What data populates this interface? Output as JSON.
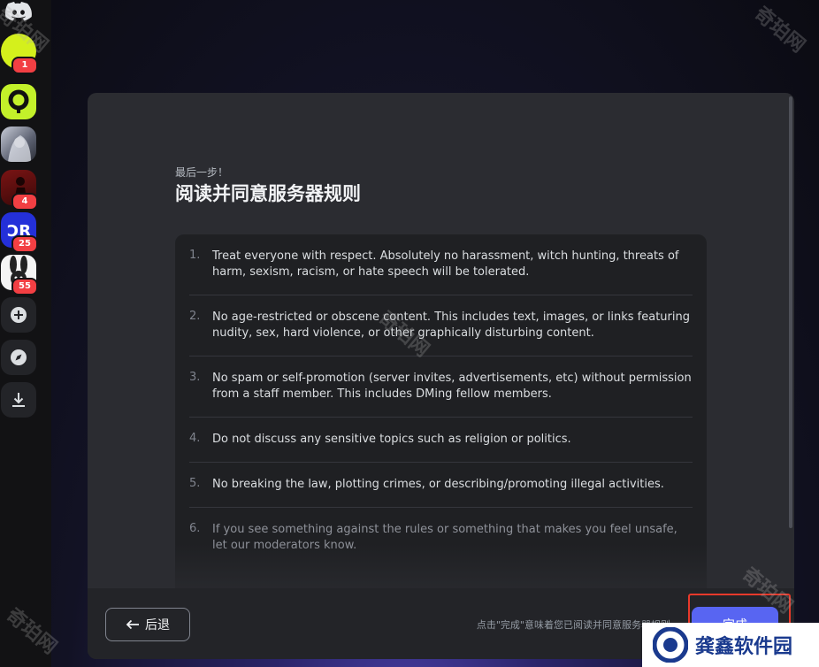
{
  "servers": [
    {
      "name": "discord-home",
      "badge": null
    },
    {
      "name": "lime-server",
      "badge": "1"
    },
    {
      "name": "green-ring-server",
      "badge": null
    },
    {
      "name": "anime-server",
      "badge": null
    },
    {
      "name": "red-figure-server",
      "badge": "4"
    },
    {
      "name": "cr-server",
      "badge": "25"
    },
    {
      "name": "bunny-server",
      "badge": "55"
    }
  ],
  "modal": {
    "step": "最后一步！",
    "title": "阅读并同意服务器规则",
    "rules": [
      {
        "num": "1.",
        "text": "Treat everyone with respect. Absolutely no harassment, witch hunting, threats of harm, sexism, racism, or hate speech will be tolerated."
      },
      {
        "num": "2.",
        "text": "No age-restricted or obscene content. This includes text, images, or links featuring nudity, sex, hard violence, or other graphically disturbing content."
      },
      {
        "num": "3.",
        "text": "No spam or self-promotion (server invites, advertisements, etc) without permission from a staff member. This includes DMing fellow members."
      },
      {
        "num": "4.",
        "text": "Do not discuss any sensitive topics such as religion or politics."
      },
      {
        "num": "5.",
        "text": "No breaking the law, plotting crimes, or describing/promoting illegal activities."
      },
      {
        "num": "6.",
        "text": "If you see something against the rules or something that makes you feel unsafe, let our moderators know."
      }
    ],
    "back_label": "后退",
    "notice": "点击\"完成\"意味着您已阅读并同意服务器规则",
    "done_label": "完成"
  },
  "watermark": "奇珀网",
  "brand": "龚鑫软件园",
  "colors": {
    "accent": "#5865f2",
    "badge": "#f23f43",
    "highlight": "#e8392b"
  }
}
